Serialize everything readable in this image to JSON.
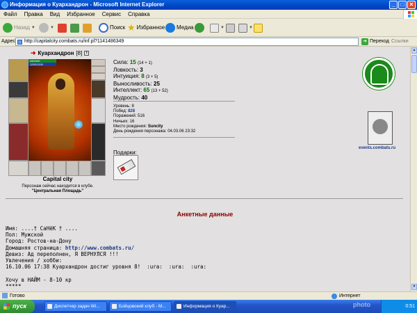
{
  "window": {
    "title": "Информация о Куархандрон - Microsoft Internet Explorer",
    "min": "_",
    "max": "□",
    "close": "✕"
  },
  "menu": {
    "items": [
      "Файл",
      "Правка",
      "Вид",
      "Избранное",
      "Сервис",
      "Справка"
    ]
  },
  "toolbar": {
    "back": "Назад",
    "search": "Поиск",
    "favorites": "Избранное",
    "media": "Медиа"
  },
  "address": {
    "label": "Адрес:",
    "url": "http://capitalcity.combats.ru/inf.pl?1141486349",
    "go": "Переход",
    "links": "Ссылки"
  },
  "character": {
    "name": "Куархандрон",
    "level": "[8]",
    "hp": "440/440",
    "mp": "1200/1200",
    "city": "Capital city",
    "location_text": "Персонаж сейчас находится в клубе.",
    "club": "\"Центральная Площадь\""
  },
  "stats": {
    "strength": {
      "label": "Сила:",
      "value": "15",
      "extra": "(14 + 1)"
    },
    "agility": {
      "label": "Ловкость:",
      "value": "3",
      "extra": ""
    },
    "intuition": {
      "label": "Интуиция:",
      "value": "8",
      "extra": "(3 + 5)"
    },
    "endurance": {
      "label": "Выносливость:",
      "value": "25",
      "extra": ""
    },
    "intellect": {
      "label": "Интеллект:",
      "value": "65",
      "extra": "(13 + 52)"
    },
    "wisdom": {
      "label": "Мудрость:",
      "value": "40",
      "extra": ""
    }
  },
  "details": {
    "level": {
      "label": "Уровень:",
      "value": "8"
    },
    "wins": {
      "label": "Побед:",
      "value": "828"
    },
    "losses": {
      "label": "Поражений:",
      "value": "516"
    },
    "draws": {
      "label": "Ничьих:",
      "value": "16"
    },
    "birthplace": {
      "label": "Место рождения:",
      "value": "Suncity"
    },
    "birthday": {
      "label": "День рождения персонажа:",
      "value": "04.03.06 23:32"
    }
  },
  "gifts": {
    "label": "Подарки:"
  },
  "events_link": "events.combats.ru",
  "anket": {
    "title": "Анкетные данные",
    "name": "Имя: ....† СаНёК † ....",
    "gender": "Пол: Мужской",
    "city": "Город: Ростов-на-Дону",
    "homepage_label": "Домашняя страница: ",
    "homepage": "http://www.combats.ru/",
    "motto": "Девиз: Ад переполнен, Я ВЕРНУЛСЯ !!!",
    "hobby_label": "Увлечения / хобби:",
    "hobby1": "16.10.06 17:38 Куархандрон достиг уровня 8!  :ura:  :ura:  :ura:",
    "hobby2": "Хочу в НАЙМ - 8-10 кр",
    "hobby3": "*****"
  },
  "statusbar": {
    "text": "Готово",
    "zone": "Интернет"
  },
  "taskbar": {
    "start": "пуск",
    "tasks": [
      "Диспетчер задач Wi...",
      "Бойцовский клуб - M...",
      "Информация о Куар..."
    ],
    "clock": "0:51"
  },
  "watermark": "photo"
}
